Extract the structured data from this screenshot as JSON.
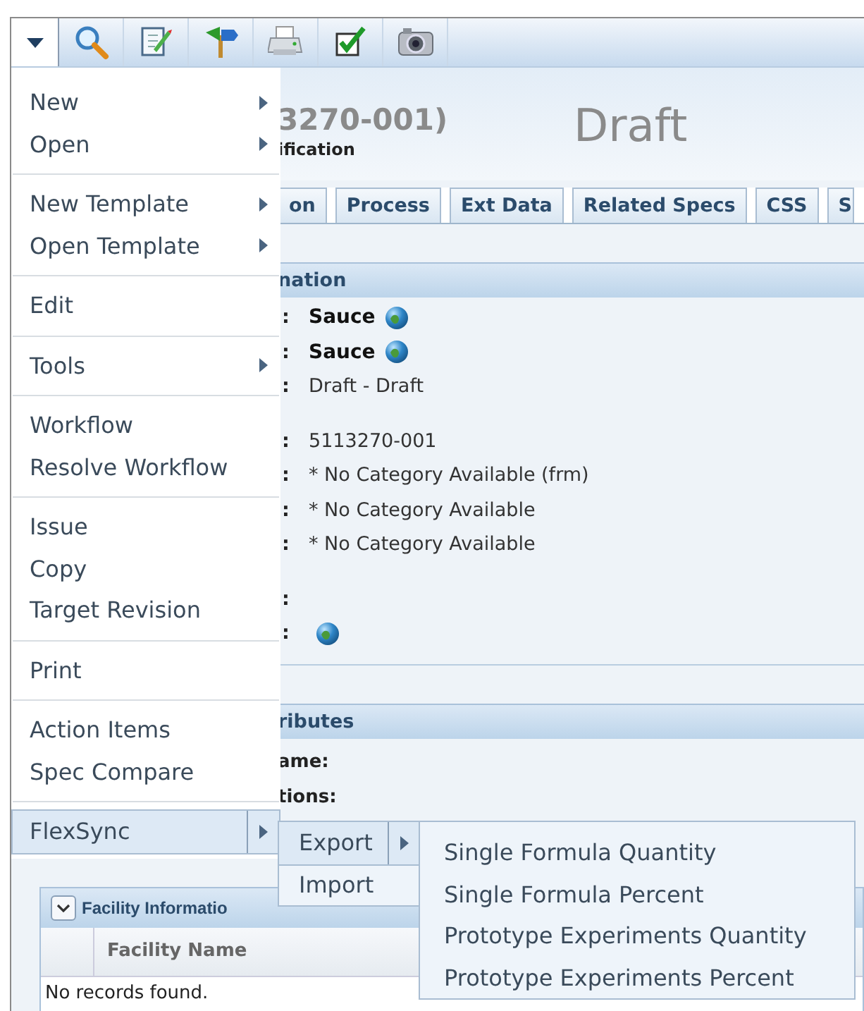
{
  "toolbar": {
    "menu_expanded": true
  },
  "header": {
    "title": "3270-001)",
    "subtitle": "ification",
    "status": "Draft"
  },
  "tabs": [
    {
      "label": "on",
      "selected": false
    },
    {
      "label": "Process",
      "selected": false
    },
    {
      "label": "Ext Data",
      "selected": false
    },
    {
      "label": "Related Specs",
      "selected": false
    },
    {
      "label": "CSS",
      "selected": false
    },
    {
      "label": "S",
      "selected": false
    }
  ],
  "general_section": {
    "title": "nation",
    "row_groups": [
      [
        {
          "label": ":",
          "value": "Sauce",
          "bold": true,
          "globe": true
        },
        {
          "label": ":",
          "value": "Sauce",
          "bold": true,
          "globe": true
        },
        {
          "label": ":",
          "value": "Draft - Draft",
          "bold": false,
          "globe": false
        }
      ],
      [
        {
          "label": ":",
          "value": "5113270-001",
          "bold": false,
          "globe": false
        },
        {
          "label": ":",
          "value": "* No Category Available (frm)",
          "bold": false,
          "globe": false
        },
        {
          "label": ":",
          "value": "* No Category Available",
          "bold": false,
          "globe": false
        },
        {
          "label": ":",
          "value": "* No Category Available",
          "bold": false,
          "globe": false
        }
      ],
      [
        {
          "label": ":",
          "globe": false
        },
        {
          "label": ":",
          "globe": true
        }
      ]
    ]
  },
  "attributes_section": {
    "title": "ributes",
    "labels": [
      "ame:",
      "tions:"
    ]
  },
  "facility_panel": {
    "title": "Facility Informatio",
    "expanded": true,
    "columns": [
      "Facility Name"
    ],
    "empty_message": "No records found."
  },
  "menu": {
    "items": [
      {
        "kind": "item",
        "label": "New",
        "submenu": true,
        "selected": false
      },
      {
        "kind": "item",
        "label": "Open",
        "submenu": true,
        "selected": false
      },
      {
        "kind": "separator"
      },
      {
        "kind": "item",
        "label": "New Template",
        "submenu": true,
        "selected": false
      },
      {
        "kind": "item",
        "label": "Open Template",
        "submenu": true,
        "selected": false
      },
      {
        "kind": "separator"
      },
      {
        "kind": "item",
        "label": "Edit",
        "submenu": false,
        "selected": false
      },
      {
        "kind": "separator"
      },
      {
        "kind": "item",
        "label": "Tools",
        "submenu": true,
        "selected": false
      },
      {
        "kind": "separator"
      },
      {
        "kind": "item",
        "label": "Workflow",
        "submenu": false,
        "selected": false
      },
      {
        "kind": "item",
        "label": "Resolve Workflow",
        "submenu": false,
        "selected": false
      },
      {
        "kind": "separator"
      },
      {
        "kind": "item",
        "label": "Issue",
        "submenu": false,
        "selected": false
      },
      {
        "kind": "item",
        "label": "Copy",
        "submenu": false,
        "selected": false
      },
      {
        "kind": "item",
        "label": "Target Revision",
        "submenu": false,
        "selected": false
      },
      {
        "kind": "separator"
      },
      {
        "kind": "item",
        "label": "Print",
        "submenu": false,
        "selected": false
      },
      {
        "kind": "separator"
      },
      {
        "kind": "item",
        "label": "Action Items",
        "submenu": false,
        "selected": false
      },
      {
        "kind": "item",
        "label": "Spec Compare",
        "submenu": false,
        "selected": false
      },
      {
        "kind": "separator"
      },
      {
        "kind": "item",
        "label": "FlexSync",
        "submenu": true,
        "selected": true
      }
    ]
  },
  "flexsync_menu": {
    "items": [
      {
        "kind": "item",
        "label": "Export",
        "submenu": true,
        "selected": true
      },
      {
        "kind": "item",
        "label": "Import",
        "submenu": false,
        "selected": false
      }
    ]
  },
  "export_menu": {
    "items": [
      {
        "kind": "item",
        "label": "Single Formula Quantity",
        "submenu": false,
        "selected": false
      },
      {
        "kind": "item",
        "label": "Single Formula Percent",
        "submenu": false,
        "selected": false
      },
      {
        "kind": "item",
        "label": "Prototype Experiments Quantity",
        "submenu": false,
        "selected": false
      },
      {
        "kind": "item",
        "label": "Prototype Experiments Percent",
        "submenu": false,
        "selected": false
      }
    ]
  }
}
